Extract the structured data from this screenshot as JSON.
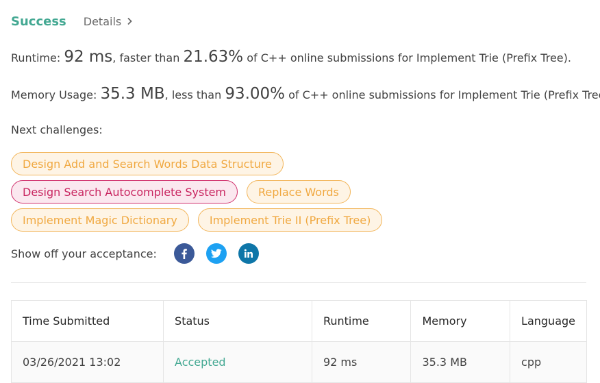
{
  "header": {
    "status": "Success",
    "details_label": "Details"
  },
  "runtime": {
    "prefix": "Runtime: ",
    "value": "92 ms",
    "middle": ", faster than ",
    "percent": "21.63%",
    "suffix": " of C++ online submissions for Implement Trie (Prefix Tree)."
  },
  "memory": {
    "prefix": "Memory Usage: ",
    "value": "35.3 MB",
    "middle": ", less than ",
    "percent": "93.00%",
    "suffix": " of C++ online submissions for Implement Trie (Prefix Tree)."
  },
  "next_challenges": {
    "label": "Next challenges:",
    "items": [
      {
        "label": "Design Add and Search Words Data Structure",
        "difficulty": "medium"
      },
      {
        "label": "Design Search Autocomplete System",
        "difficulty": "hard"
      },
      {
        "label": "Replace Words",
        "difficulty": "medium"
      },
      {
        "label": "Implement Magic Dictionary",
        "difficulty": "medium"
      },
      {
        "label": "Implement Trie II (Prefix Tree)",
        "difficulty": "medium"
      }
    ]
  },
  "share": {
    "label": "Show off your acceptance:",
    "icons": [
      "facebook-icon",
      "twitter-icon",
      "linkedin-icon"
    ]
  },
  "colors": {
    "success": "#43a892",
    "medium": "#f0a840",
    "hard": "#c8245f",
    "facebook": "#3b5998",
    "twitter": "#1da1f2",
    "linkedin": "#0e76a8"
  },
  "submissions": {
    "headers": [
      "Time Submitted",
      "Status",
      "Runtime",
      "Memory",
      "Language"
    ],
    "rows": [
      [
        "03/26/2021 13:02",
        "Accepted",
        "92 ms",
        "35.3 MB",
        "cpp"
      ]
    ]
  }
}
